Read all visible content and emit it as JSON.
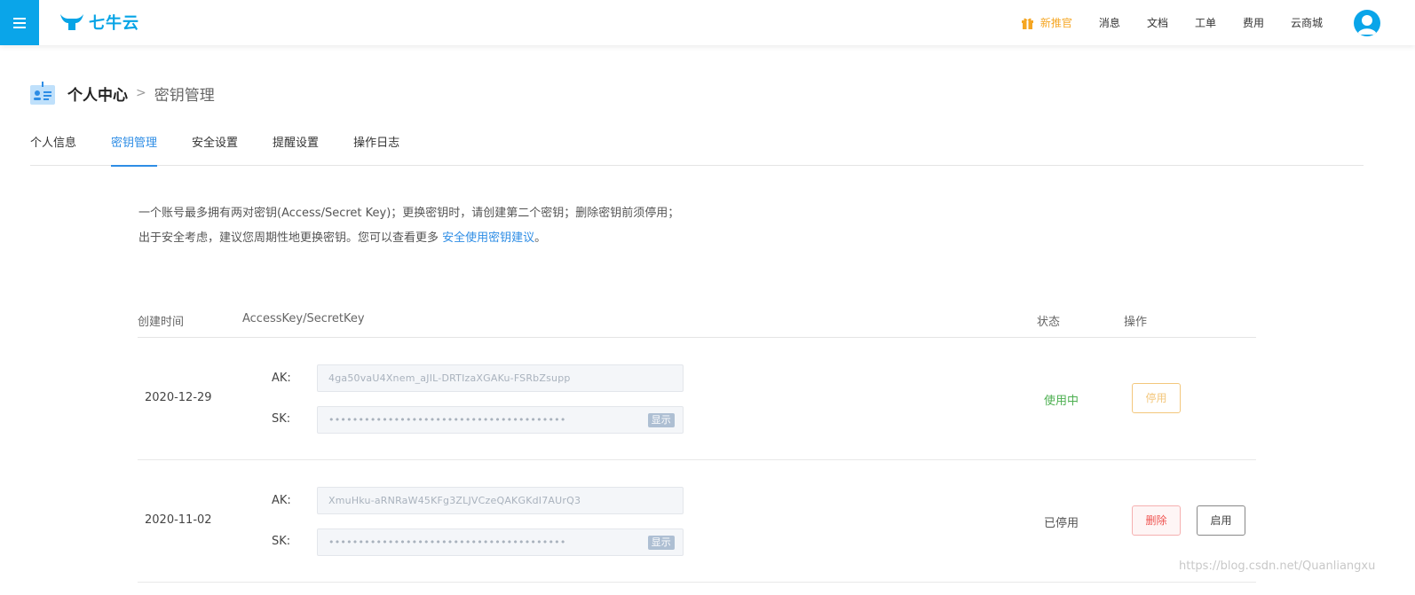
{
  "header": {
    "logo_text": "七牛云",
    "nav": [
      {
        "label": "新推官"
      },
      {
        "label": "消息"
      },
      {
        "label": "文档"
      },
      {
        "label": "工单"
      },
      {
        "label": "费用"
      },
      {
        "label": "云商城"
      }
    ]
  },
  "breadcrumb": {
    "home": "个人中心",
    "separator": ">",
    "current": "密钥管理"
  },
  "tabs": [
    {
      "label": "个人信息"
    },
    {
      "label": "密钥管理",
      "active": true
    },
    {
      "label": "安全设置"
    },
    {
      "label": "提醒设置"
    },
    {
      "label": "操作日志"
    }
  ],
  "intro": {
    "text": "一个账号最多拥有两对密钥(Access/Secret Key)；更换密钥时，请创建第二个密钥；删除密钥前须停用；出于安全考虑，建议您周期性地更换密钥。您可以查看更多 ",
    "link": "安全使用密钥建议",
    "tail": "。"
  },
  "table": {
    "headers": {
      "created": "创建时间",
      "keys": "AccessKey/SecretKey",
      "status": "状态",
      "actions": "操作"
    },
    "ak_label": "AK:",
    "sk_label": "SK:",
    "show_label": "显示",
    "rows": [
      {
        "date": "2020-12-29",
        "ak": "4ga50vaU4Xnem_aJIL-DRTIzaXGAKu-FSRbZsupp",
        "sk": "••••••••••••••••••••••••••••••••••••••••",
        "status": "使用中",
        "actions": [
          "停用"
        ]
      },
      {
        "date": "2020-11-02",
        "ak": "XmuHku-aRNRaW45KFg3ZLJVCzeQAKGKdI7AUrQ3",
        "sk": "••••••••••••••••••••••••••••••••••••••••",
        "status": "已停用",
        "actions": [
          "删除",
          "启用"
        ]
      }
    ]
  },
  "watermark": "https://blog.csdn.net/Quanliangxu",
  "colors": {
    "brand": "#0aa5e9",
    "accent": "#2e8de5",
    "active_status": "#4caf50",
    "promo": "#f5a623"
  }
}
